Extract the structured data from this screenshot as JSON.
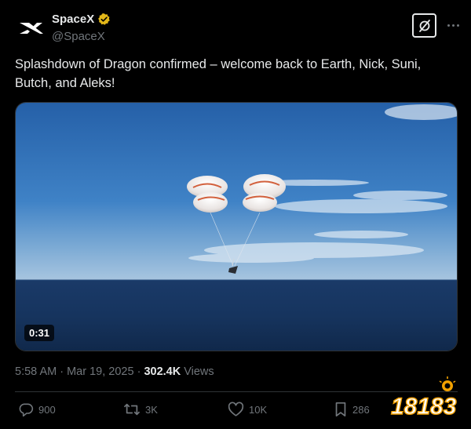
{
  "author": {
    "display_name": "SpaceX",
    "handle": "@SpaceX"
  },
  "tweet": {
    "text": "Splashdown of Dragon confirmed – welcome back to Earth, Nick, Suni, Butch, and Aleks!"
  },
  "media": {
    "duration": "0:31"
  },
  "meta": {
    "time": "5:58 AM",
    "separator1": " · ",
    "date": "Mar 19, 2025",
    "separator2": " · ",
    "views_count": "302.4K",
    "views_label": " Views"
  },
  "actions": {
    "replies": "900",
    "reposts": "3K",
    "likes": "10K",
    "bookmarks": "286"
  },
  "watermark": {
    "text": "18183"
  },
  "icons": {
    "verified": "verified-badge-icon",
    "grok": "grok-icon",
    "more": "more-dots-icon",
    "reply": "reply-icon",
    "repost": "repost-icon",
    "like": "heart-icon",
    "bookmark": "bookmark-icon"
  },
  "colors": {
    "background": "#000000",
    "text": "#e7e9ea",
    "muted": "#71767b",
    "verified_gold": "#e2b719"
  }
}
